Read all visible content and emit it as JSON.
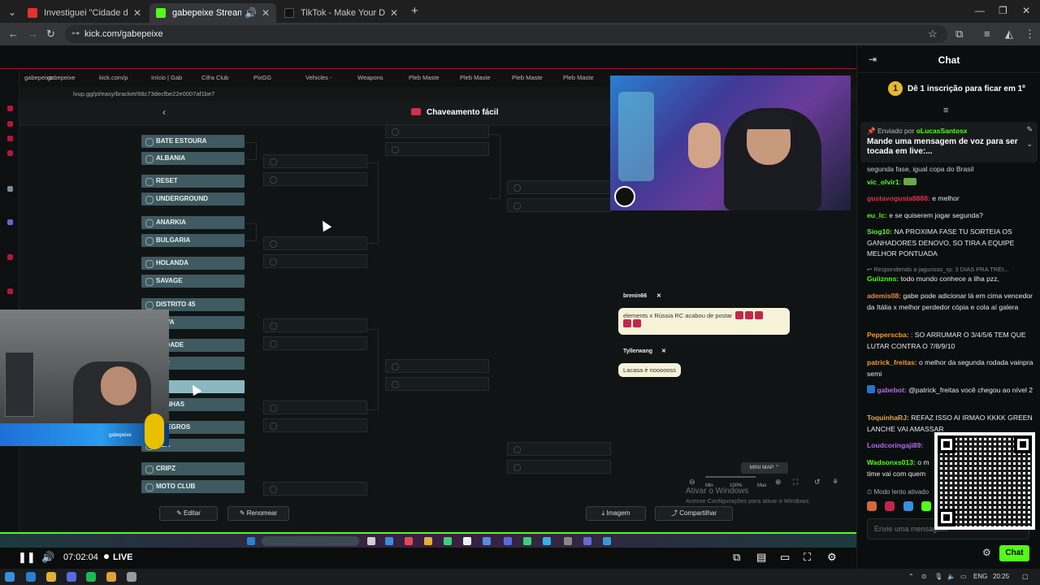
{
  "browser": {
    "tabs": [
      {
        "title": "Investiguei \"Cidade do Crime\"",
        "color": "#e5302f",
        "active": false
      },
      {
        "title": "gabepeixe Stream - Watch",
        "color": "#53fc18",
        "active": true
      },
      {
        "title": "TikTok - Make Your Day",
        "color": "#111111",
        "active": false
      }
    ],
    "url": "kick.com/gabepeixe"
  },
  "stream": {
    "inner_bookmarks": [
      "gabepeixe",
      "kick.com/p",
      "Início | Gab",
      "Cifra Club",
      "PixGG",
      "Vehicles -",
      "Weapons",
      "Pleb Maste",
      "Pleb Maste",
      "Pleb Maste",
      "Pleb Maste"
    ],
    "inner_url": "lvup.gg/pt/easy/bracket/68c73decfbe22e0007af1be7",
    "bracket_title": "Chaveamento fácil",
    "teams": [
      "BATE ESTOURA",
      "ALBANIA",
      "RESET",
      "UNDERGROUND",
      "ANARKIA",
      "BULGARIA",
      "HOLANDA",
      "SAVAGE",
      "DISTRITO 45",
      "NOVA",
      "ANDADE",
      "KER",
      "",
      "ETINHAS",
      "S NEGROS",
      "NCA",
      "CRIPZ",
      "MOTO CLUB"
    ],
    "overlay": {
      "user1": "brenin66",
      "msg1": "elements x Rússia RC acabou de postar",
      "user2": "Tyllerwang",
      "msg2": "Lacasa é noooooss"
    },
    "minimap": "MINI MAP",
    "zoom_min": "Min",
    "zoom_pct": "100%",
    "zoom_max": "Max",
    "watermark_title": "Ativar o Windows",
    "watermark_sub": "Acesse Configurações para ativar o Windows.",
    "buttons": {
      "edit": "Editar",
      "rename": "Renomear",
      "image": "Imagem",
      "share": "Compartilhar"
    },
    "cam_name": "gabepeixe"
  },
  "player": {
    "time": "07:02:04",
    "live": "LIVE"
  },
  "chat": {
    "title": "Chat",
    "sub_count": "1",
    "sub_text": "Dê 1 inscrição para ficar em 1º",
    "pinned_by_label": "Enviado por",
    "pinned_by_user": "oLucasSantosx",
    "pinned_msg": "Mande uma mensagem de voz para ser tocada em live:...",
    "partial_line": "segunda fase, igual copa do Brasil",
    "messages": [
      {
        "user": "vic_olvir1:",
        "text": "",
        "color": "#53fc18"
      },
      {
        "user": "gustavogusta8888:",
        "text": "e melhor",
        "color": "#e0324a"
      },
      {
        "user": "eu_lc:",
        "text": "e se quiserem jogar segunda?",
        "color": "#53fc18"
      },
      {
        "user": "Siog10:",
        "text": "NA PROXIMA FASE TU SORTEIA OS GANHADORES DENOVO, SO TIRA A EQUIPE MELHOR PONTUADA",
        "color": "#53fc18"
      },
      {
        "user": "Guiiznns:",
        "text": "todo mundo conhece a ilha pzz,",
        "color": "#53fc18"
      },
      {
        "user": "ademis08:",
        "text": "gabe pode adicionar lá em cima vencedor da Itália x melhor perdedor cópia e cola aí galera",
        "color": "#f0883a"
      },
      {
        "user": "Pepperscba:",
        "text": ": SO ARRUMAR O 3/4/5/6 TEM QUE LUTAR CONTRA O 7/8/9/10",
        "color": "#f09a3a"
      },
      {
        "user": "patrick_freitas:",
        "text": "o melhor da segunda rodada vainpra semi",
        "color": "#f09a3a"
      },
      {
        "user": "gabebot:",
        "text": "@patrick_freitas você chegou ao nível 2",
        "color": "#b16cf0"
      },
      {
        "user": "ToquinhaRJ:",
        "text": "REFAZ ISSO AI IRMAO KKKK GREEN LANCHE VAI AMASSAR",
        "color": "#f0a53a"
      },
      {
        "user": "Loudcoringaji89:",
        "text": "",
        "color": "#b16cf0"
      },
      {
        "user": "Wadsonxs013:",
        "text": "o m time vai com quem",
        "color": "#53fc18"
      }
    ],
    "reply_text": "Respondendo a jagunsso_rp: 3 DIAS PRA TREI...",
    "slow_mode": "Modo lento ativado",
    "input_placeholder": "Envie uma mensagem",
    "chat_button": "Chat"
  },
  "taskbar": {
    "lang": "ENG",
    "clock": "20:25"
  }
}
